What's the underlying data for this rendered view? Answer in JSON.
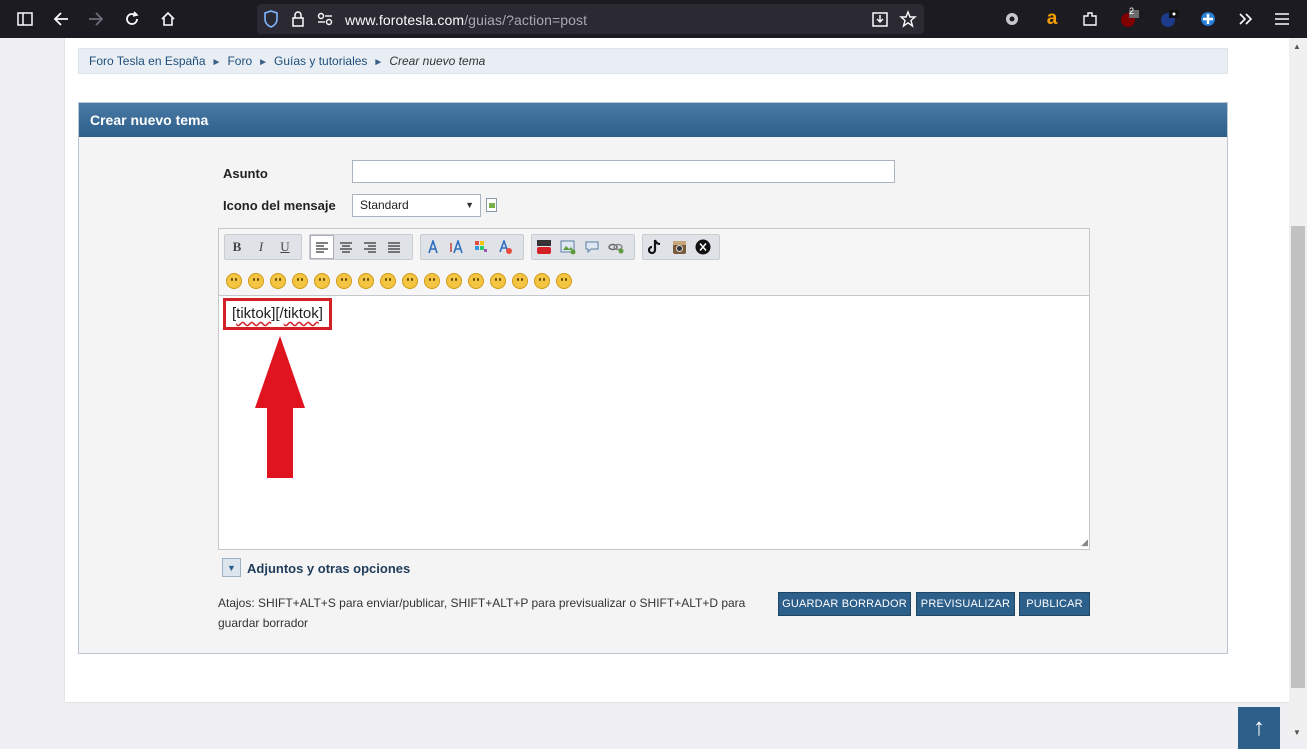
{
  "browser": {
    "url_host": "www.forotesla.com",
    "url_path": "/guias/?action=post",
    "extension_badge": "2"
  },
  "breadcrumb": {
    "items": [
      "Foro Tesla en España",
      "Foro",
      "Guías y tutoriales"
    ],
    "current": "Crear nuevo tema",
    "separator": "►"
  },
  "form": {
    "title": "Crear nuevo tema",
    "subject_label": "Asunto",
    "subject_value": "",
    "icon_label": "Icono del mensaje",
    "icon_selected": "Standard",
    "editor_text_open": "[tiktok]",
    "editor_text_close": "[/tiktok]",
    "toolbar": {
      "bold": "B",
      "italic": "I",
      "underline": "U"
    },
    "attachments_label": "Adjuntos y otras opciones",
    "shortcuts_text": "Atajos: SHIFT+ALT+S para enviar/publicar, SHIFT+ALT+P para previsualizar o SHIFT+ALT+D para guardar borrador",
    "buttons": {
      "save_draft": "GUARDAR BORRADOR",
      "preview": "PREVISUALIZAR",
      "publish": "PUBLICAR"
    }
  },
  "scroll_top": "↑"
}
